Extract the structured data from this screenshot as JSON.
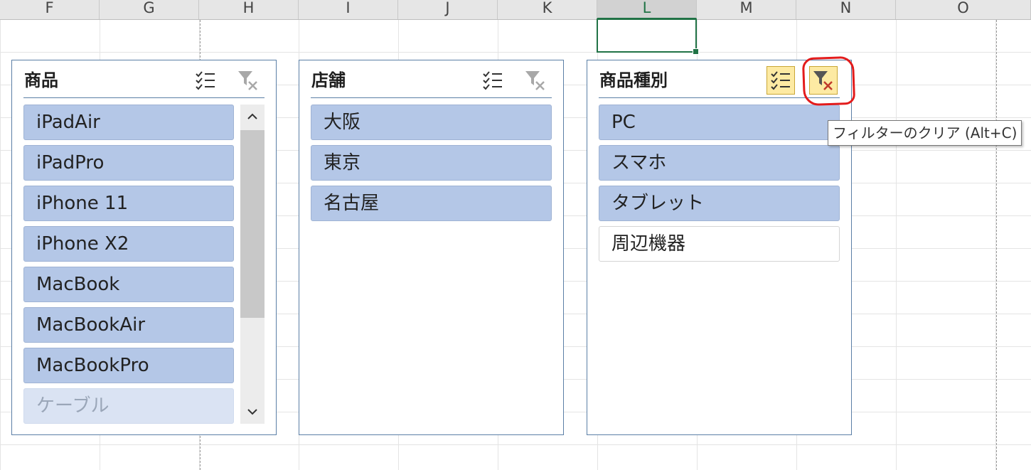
{
  "columns": [
    {
      "label": "F",
      "active": false
    },
    {
      "label": "G",
      "active": false
    },
    {
      "label": "H",
      "active": false
    },
    {
      "label": "I",
      "active": false
    },
    {
      "label": "J",
      "active": false
    },
    {
      "label": "K",
      "active": false
    },
    {
      "label": "L",
      "active": true
    },
    {
      "label": "M",
      "active": false
    },
    {
      "label": "N",
      "active": false
    },
    {
      "label": "O",
      "active": false
    }
  ],
  "colors": {
    "selected": "#b4c7e7",
    "border": "#5b7fa6",
    "highlight": "#e31b1b",
    "active_button": "#fdeaa3",
    "excel_green": "#217346"
  },
  "slicers": [
    {
      "title": "商品",
      "multiselect_on": false,
      "clear_on": false,
      "items": [
        {
          "label": "iPadAir",
          "state": "selected"
        },
        {
          "label": "iPadPro",
          "state": "selected"
        },
        {
          "label": "iPhone 11",
          "state": "selected"
        },
        {
          "label": "iPhone X2",
          "state": "selected"
        },
        {
          "label": "MacBook",
          "state": "selected"
        },
        {
          "label": "MacBookAir",
          "state": "selected"
        },
        {
          "label": "MacBookPro",
          "state": "selected"
        },
        {
          "label": "ケーブル",
          "state": "nodata"
        }
      ],
      "has_scrollbar": true
    },
    {
      "title": "店舗",
      "multiselect_on": false,
      "clear_on": false,
      "items": [
        {
          "label": "大阪",
          "state": "selected"
        },
        {
          "label": "東京",
          "state": "selected"
        },
        {
          "label": "名古屋",
          "state": "selected"
        }
      ],
      "has_scrollbar": false
    },
    {
      "title": "商品種別",
      "multiselect_on": true,
      "clear_on": true,
      "items": [
        {
          "label": "PC",
          "state": "selected"
        },
        {
          "label": "スマホ",
          "state": "selected"
        },
        {
          "label": "タブレット",
          "state": "selected"
        },
        {
          "label": "周辺機器",
          "state": "off"
        }
      ],
      "has_scrollbar": false
    }
  ],
  "icons": {
    "multiselect": "multi-select-icon",
    "clear_filter": "clear-filter-icon",
    "scroll_up": "chevron-up-icon",
    "scroll_down": "chevron-down-icon"
  },
  "tooltip": {
    "text": "フィルターのクリア (Alt+C)"
  }
}
